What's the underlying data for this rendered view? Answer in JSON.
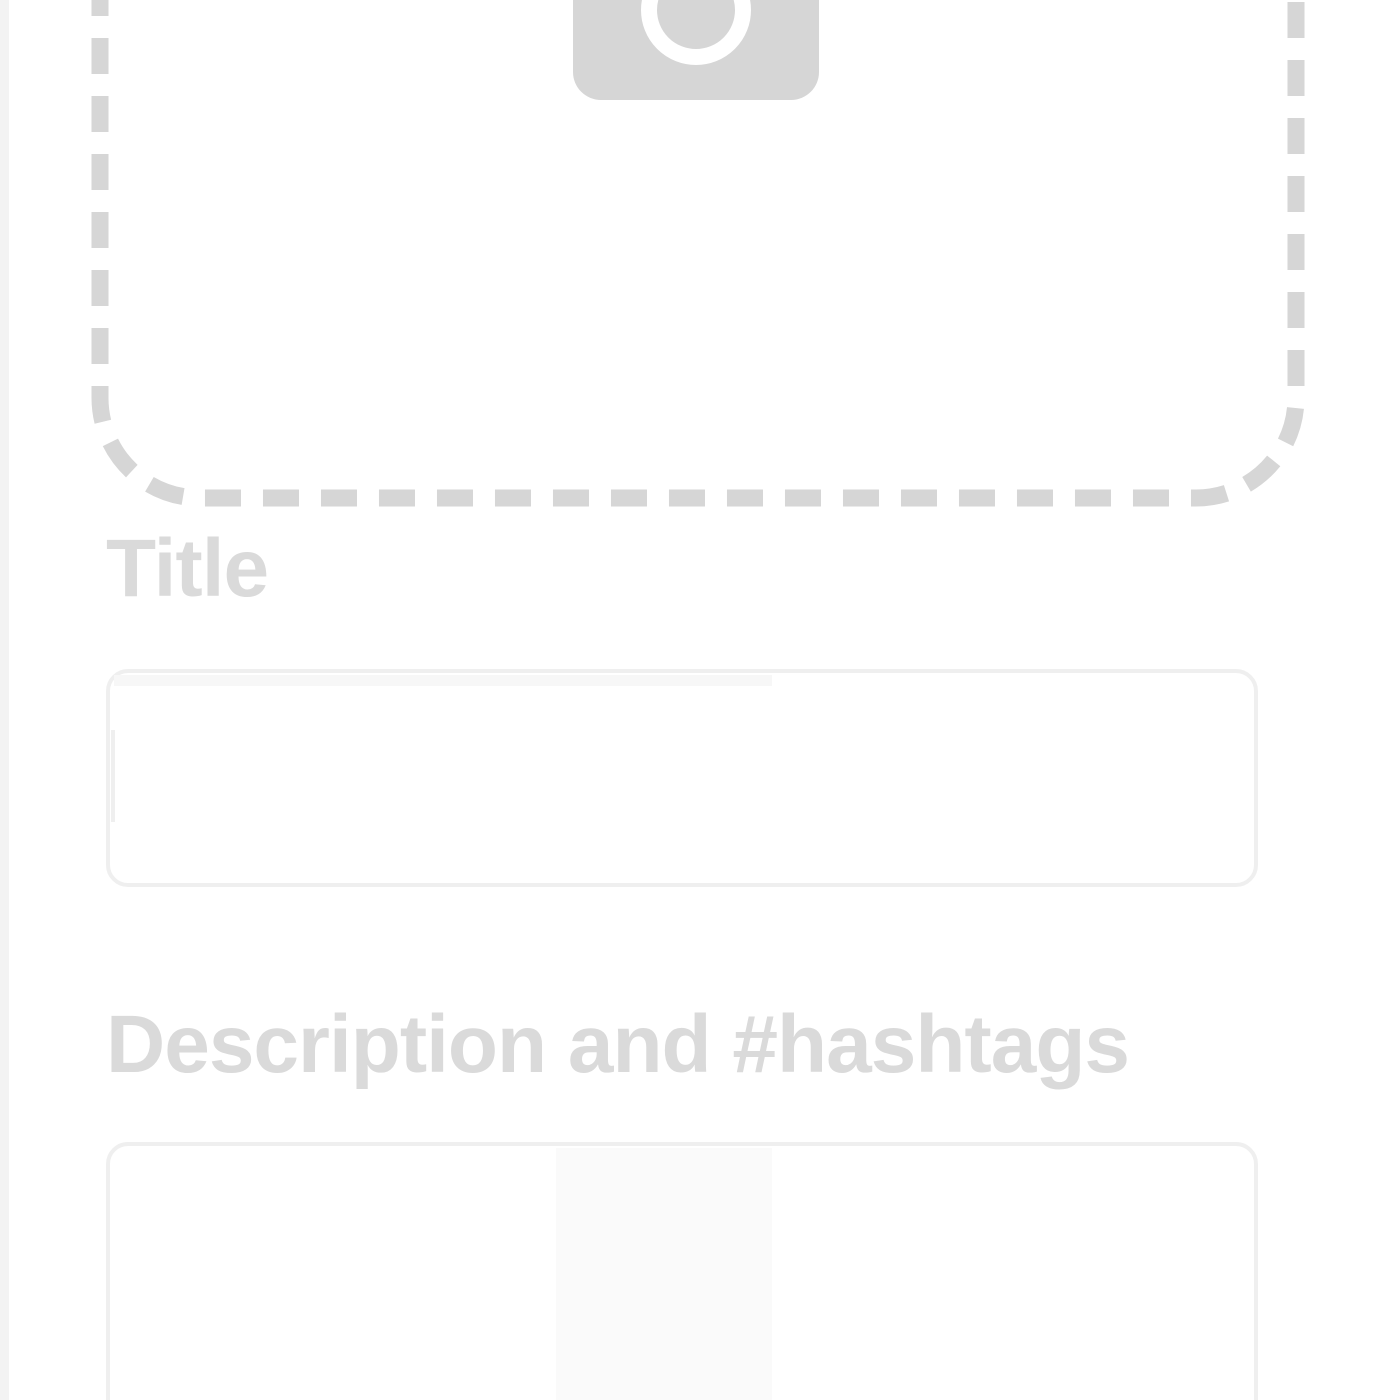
{
  "upload": {
    "icon": "camera-icon",
    "border_color": "#d6d6d6",
    "icon_color": "#d6d6d6"
  },
  "title_field": {
    "label": "Title",
    "value": "",
    "placeholder": ""
  },
  "description_field": {
    "label": "Description and #hashtags",
    "value": "",
    "placeholder": ""
  },
  "colors": {
    "label": "#dadada",
    "field_border": "#efefef",
    "background": "#ffffff"
  }
}
